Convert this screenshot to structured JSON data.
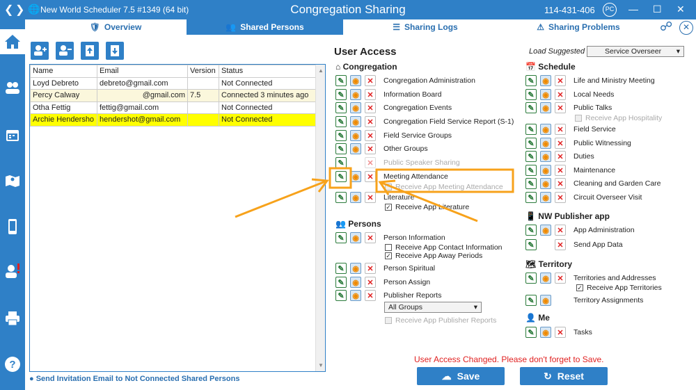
{
  "window": {
    "app_title": "New World Scheduler 7.5 #1349 (64 bit)",
    "page_title": "Congregation Sharing",
    "phone": "114-431-406",
    "profile_initials": "PC"
  },
  "tabs": [
    {
      "label": "Overview",
      "icon": "overview-icon",
      "active": false
    },
    {
      "label": "Shared Persons",
      "icon": "shared-persons-icon",
      "active": true
    },
    {
      "label": "Sharing Logs",
      "icon": "list-icon",
      "active": false
    },
    {
      "label": "Sharing Problems",
      "icon": "warning-icon",
      "active": false
    }
  ],
  "toolbar": [
    "add-person-icon",
    "remove-person-icon",
    "upload-icon",
    "download-icon"
  ],
  "persons_table": {
    "columns": [
      "Name",
      "Email",
      "Version",
      "Status"
    ],
    "rows": [
      {
        "name": "Loyd Debreto",
        "email": "debreto@gmail.com",
        "version": "",
        "status": "Not Connected"
      },
      {
        "name": "Percy Calway",
        "email": "@gmail.com",
        "version": "7.5",
        "status": "Connected 3 minutes ago"
      },
      {
        "name": "Otha Fettig",
        "email": "fettig@gmail.com",
        "version": "",
        "status": "Not Connected"
      },
      {
        "name": "Archie Hendersho",
        "email": "hendershot@gmail.com",
        "version": "",
        "status": "Not Connected"
      }
    ]
  },
  "invite_link": "Send Invitation Email to Not Connected Shared Persons",
  "user_access": {
    "title": "User Access",
    "load_suggested_label": "Load Suggested",
    "load_suggested_value": "Service Overseer",
    "congregation": {
      "title": "Congregation",
      "items": [
        "Congregation Administration",
        "Information Board",
        "Congregation Events",
        "Congregation Field Service Report (S-1)",
        "Field Service Groups",
        "Other Groups",
        "Public Speaker Sharing",
        "Meeting Attendance",
        "Literature"
      ],
      "checks": [
        "Receive App Meeting Attendance",
        "Receive App Literature"
      ]
    },
    "persons": {
      "title": "Persons",
      "items": [
        "Person Information",
        "Person Spiritual",
        "Person Assign",
        "Publisher Reports"
      ],
      "checks": [
        "Receive App Contact Information",
        "Receive App Away Periods",
        "Receive App Publisher Reports"
      ],
      "groups_value": "All Groups"
    },
    "schedule": {
      "title": "Schedule",
      "items": [
        "Life and Ministry Meeting",
        "Local Needs",
        "Public Talks",
        "Field Service",
        "Public Witnessing",
        "Duties",
        "Maintenance",
        "Cleaning and Garden Care",
        "Circuit Overseer Visit"
      ],
      "checks": [
        "Receive App Hospitality"
      ]
    },
    "publisher_app": {
      "title": "NW Publisher app",
      "items": [
        "App Administration",
        "Send App Data"
      ]
    },
    "territory": {
      "title": "Territory",
      "items": [
        "Territories and Addresses",
        "Territory Assignments"
      ],
      "checks": [
        "Receive App Territories"
      ]
    },
    "me": {
      "title": "Me",
      "items": [
        "Tasks"
      ]
    }
  },
  "save_warning": "User Access Changed. Please don't forget to Save.",
  "buttons": {
    "save": "Save",
    "reset": "Reset"
  },
  "colors": {
    "accent": "#2f80c7",
    "highlight": "#ffff00",
    "warning": "#e02020",
    "annotation": "#f7a21b"
  }
}
